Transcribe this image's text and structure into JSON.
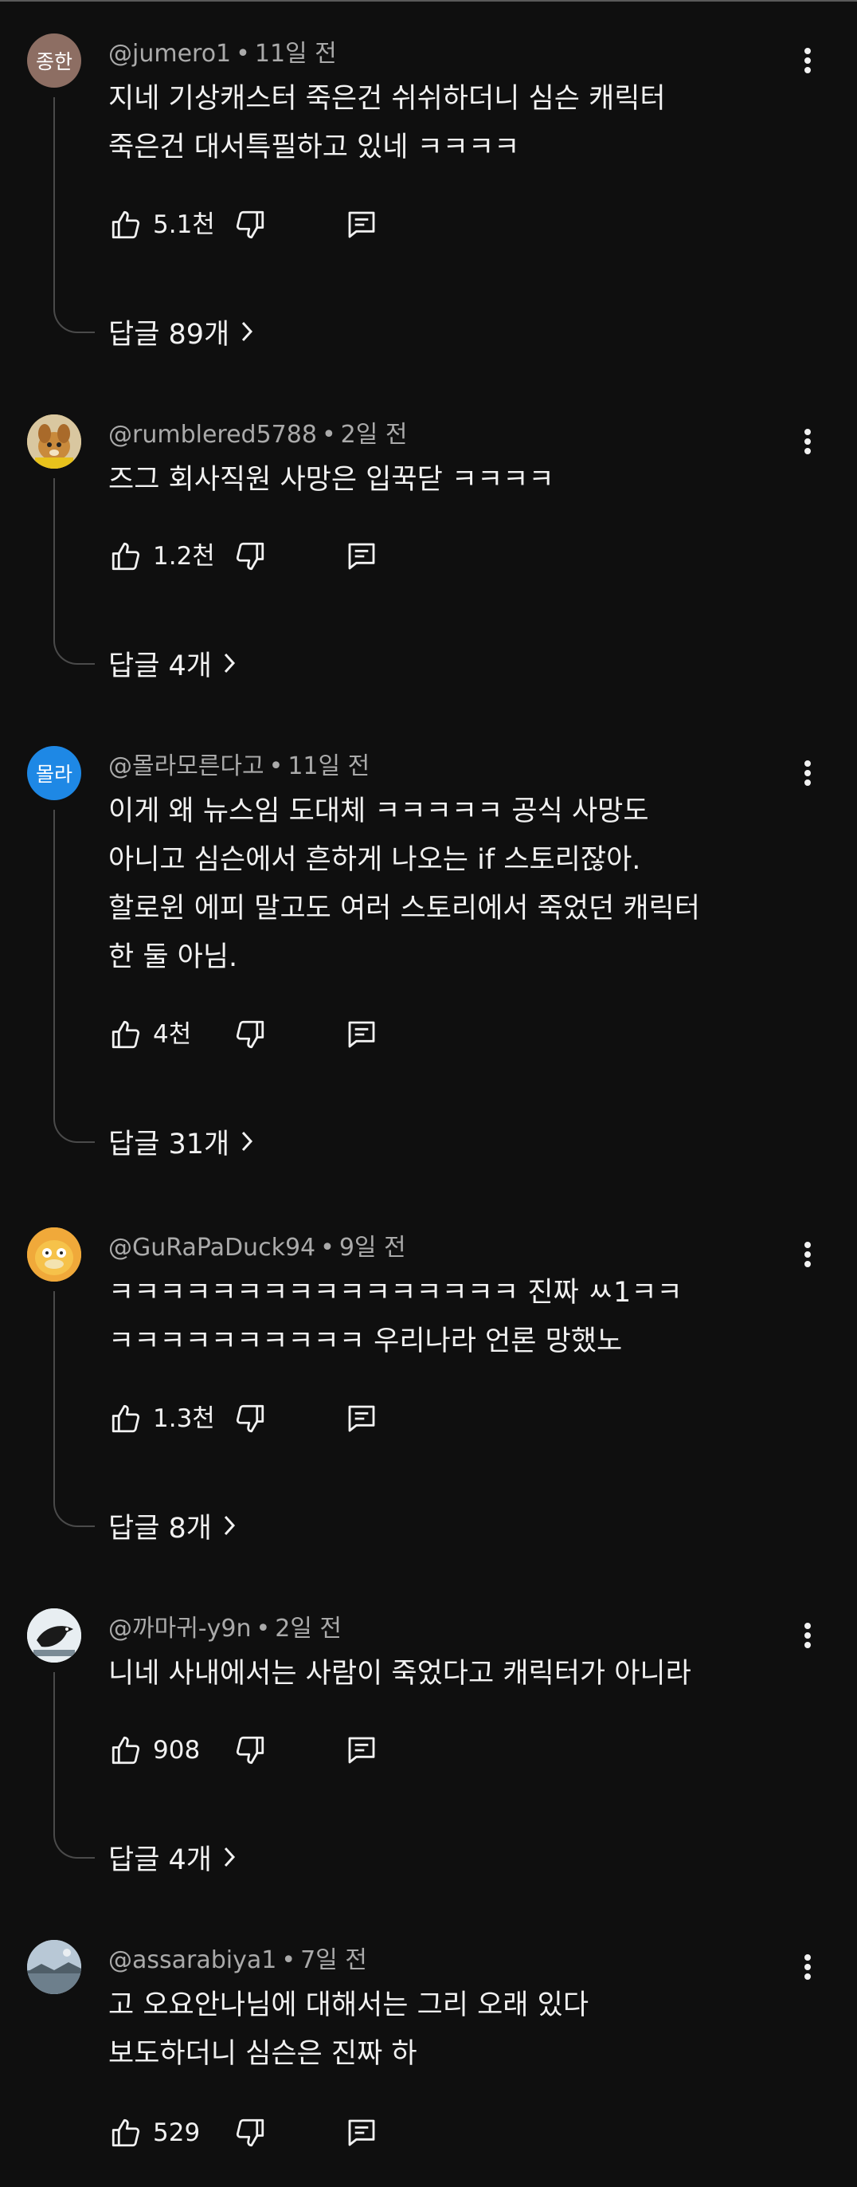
{
  "comments": [
    {
      "avatar_text": "종한",
      "avatar_color": "#8d6e63",
      "avatar_icon": "",
      "handle": "@jumero1",
      "time": "11일 전",
      "text": "지네 기상캐스터 죽은건 쉬쉬하더니 심슨 캐릭터\n죽은건 대서특필하고 있네 ㅋㅋㅋㅋ",
      "likes": "5.1천",
      "replies": "답글 89개"
    },
    {
      "avatar_text": "",
      "avatar_color": "#e3b23c",
      "avatar_icon": "dog-avatar-icon",
      "handle": "@rumblered5788",
      "time": "2일 전",
      "text": "즈그 회사직원 사망은 입꾹닫 ㅋㅋㅋㅋ",
      "likes": "1.2천",
      "replies": "답글 4개"
    },
    {
      "avatar_text": "몰라",
      "avatar_color": "#1e88e5",
      "avatar_icon": "",
      "handle": "@몰라모른다고",
      "time": "11일 전",
      "text": "이게 왜 뉴스임 도대체 ㅋㅋㅋㅋㅋ 공식 사망도\n아니고 심슨에서 흔하게 나오는 if 스토리잖아.\n할로윈 에피 말고도 여러 스토리에서 죽었던 캐릭터\n한 둘 아님.",
      "likes": "4천",
      "replies": "답글 31개"
    },
    {
      "avatar_text": "",
      "avatar_color": "#f0a93a",
      "avatar_icon": "psyduck-avatar-icon",
      "handle": "@GuRaPaDuck94",
      "time": "9일 전",
      "text": "ㅋㅋㅋㅋㅋㅋㅋㅋㅋㅋㅋㅋㅋㅋㅋㅋ 진짜 ㅆ1ㅋㅋ\nㅋㅋㅋㅋㅋㅋㅋㅋㅋㅋ 우리나라 언론 망했노",
      "likes": "1.3천",
      "replies": "답글 8개"
    },
    {
      "avatar_text": "",
      "avatar_color": "#e8eef2",
      "avatar_icon": "crow-avatar-icon",
      "handle": "@까마귀-y9n",
      "time": "2일 전",
      "text": "니네 사내에서는 사람이 죽었다고 캐릭터가 아니라",
      "likes": "908",
      "replies": "답글 4개"
    },
    {
      "avatar_text": "",
      "avatar_color": "#9fb3c8",
      "avatar_icon": "landscape-avatar-icon",
      "handle": "@assarabiya1",
      "time": "7일 전",
      "text": "고 오요안나님에 대해서는 그리 오래 있다\n보도하더니 심슨은 진짜 하",
      "likes": "529",
      "replies": ""
    }
  ],
  "icons": {
    "like": "thumbs-up-icon",
    "dislike": "thumbs-down-icon",
    "reply": "comment-reply-icon",
    "more": "more-vert-icon",
    "chevron": "chevron-right-icon"
  },
  "colors": {
    "background": "#0f0f0f",
    "text": "#f1f1f1",
    "meta_text": "#aaaaaa",
    "thread_line": "#4a4a4a"
  }
}
